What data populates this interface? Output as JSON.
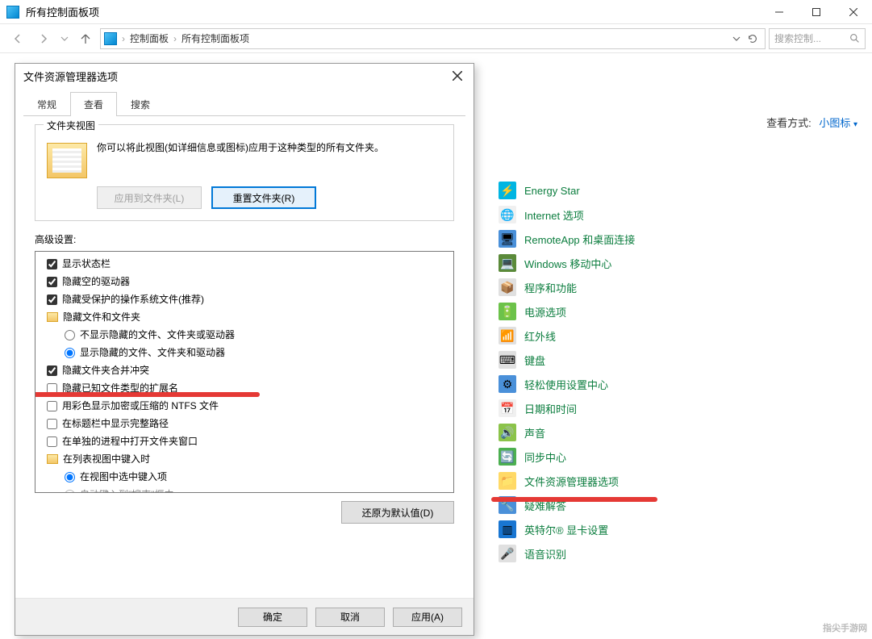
{
  "window": {
    "title": "所有控制面板项"
  },
  "nav": {
    "crumb1": "控制面板",
    "crumb2": "所有控制面板项",
    "search_placeholder": "搜索控制..."
  },
  "view_mode": {
    "label": "查看方式:",
    "value": "小图标"
  },
  "cp_items": [
    {
      "label": "Energy Star",
      "icon": "⚡",
      "bg": "#00b5e2"
    },
    {
      "label": "Internet 选项",
      "icon": "🌐",
      "bg": "#f0f0f0"
    },
    {
      "label": "RemoteApp 和桌面连接",
      "icon": "🖥",
      "bg": "#4a90d9"
    },
    {
      "label": "Windows 移动中心",
      "icon": "💻",
      "bg": "#5b8a3a"
    },
    {
      "label": "程序和功能",
      "icon": "📦",
      "bg": "#e0e0e0"
    },
    {
      "label": "电源选项",
      "icon": "🔋",
      "bg": "#6cc24a"
    },
    {
      "label": "红外线",
      "icon": "📶",
      "bg": "#e0e0e0"
    },
    {
      "label": "键盘",
      "icon": "⌨",
      "bg": "#e0e0e0"
    },
    {
      "label": "轻松使用设置中心",
      "icon": "⚙",
      "bg": "#4a90d9"
    },
    {
      "label": "日期和时间",
      "icon": "📅",
      "bg": "#f0f0f0"
    },
    {
      "label": "声音",
      "icon": "🔊",
      "bg": "#8bc34a"
    },
    {
      "label": "同步中心",
      "icon": "🔄",
      "bg": "#4caf50"
    },
    {
      "label": "文件资源管理器选项",
      "icon": "📁",
      "bg": "#ffd966"
    },
    {
      "label": "疑难解答",
      "icon": "🔧",
      "bg": "#4a90d9"
    },
    {
      "label": "英特尔® 显卡设置",
      "icon": "▥",
      "bg": "#1976d2"
    },
    {
      "label": "语音识别",
      "icon": "🎤",
      "bg": "#e0e0e0"
    }
  ],
  "dialog": {
    "title": "文件资源管理器选项",
    "tabs": {
      "general": "常规",
      "view": "查看",
      "search": "搜索"
    },
    "folder_view": {
      "legend": "文件夹视图",
      "text": "你可以将此视图(如详细信息或图标)应用于这种类型的所有文件夹。",
      "apply_btn": "应用到文件夹(L)",
      "reset_btn": "重置文件夹(R)"
    },
    "advanced_label": "高级设置:",
    "tree": {
      "show_status_bar": "显示状态栏",
      "hide_empty_drives": "隐藏空的驱动器",
      "hide_protected_os": "隐藏受保护的操作系统文件(推荐)",
      "hidden_files_folder": "隐藏文件和文件夹",
      "dont_show_hidden": "不显示隐藏的文件、文件夹或驱动器",
      "show_hidden": "显示隐藏的文件、文件夹和驱动器",
      "hide_merge_conflicts": "隐藏文件夹合并冲突",
      "hide_extensions": "隐藏已知文件类型的扩展名",
      "color_encrypted": "用彩色显示加密或压缩的 NTFS 文件",
      "show_full_path": "在标题栏中显示完整路径",
      "separate_process": "在单独的进程中打开文件夹窗口",
      "list_typing": "在列表视图中键入时",
      "select_typed": "在视图中选中键入项",
      "auto_typed": "自动键入到\"搜索\"框中"
    },
    "restore_defaults": "还原为默认值(D)",
    "ok": "确定",
    "cancel": "取消",
    "apply": "应用(A)"
  },
  "watermark": "指尖手游网"
}
